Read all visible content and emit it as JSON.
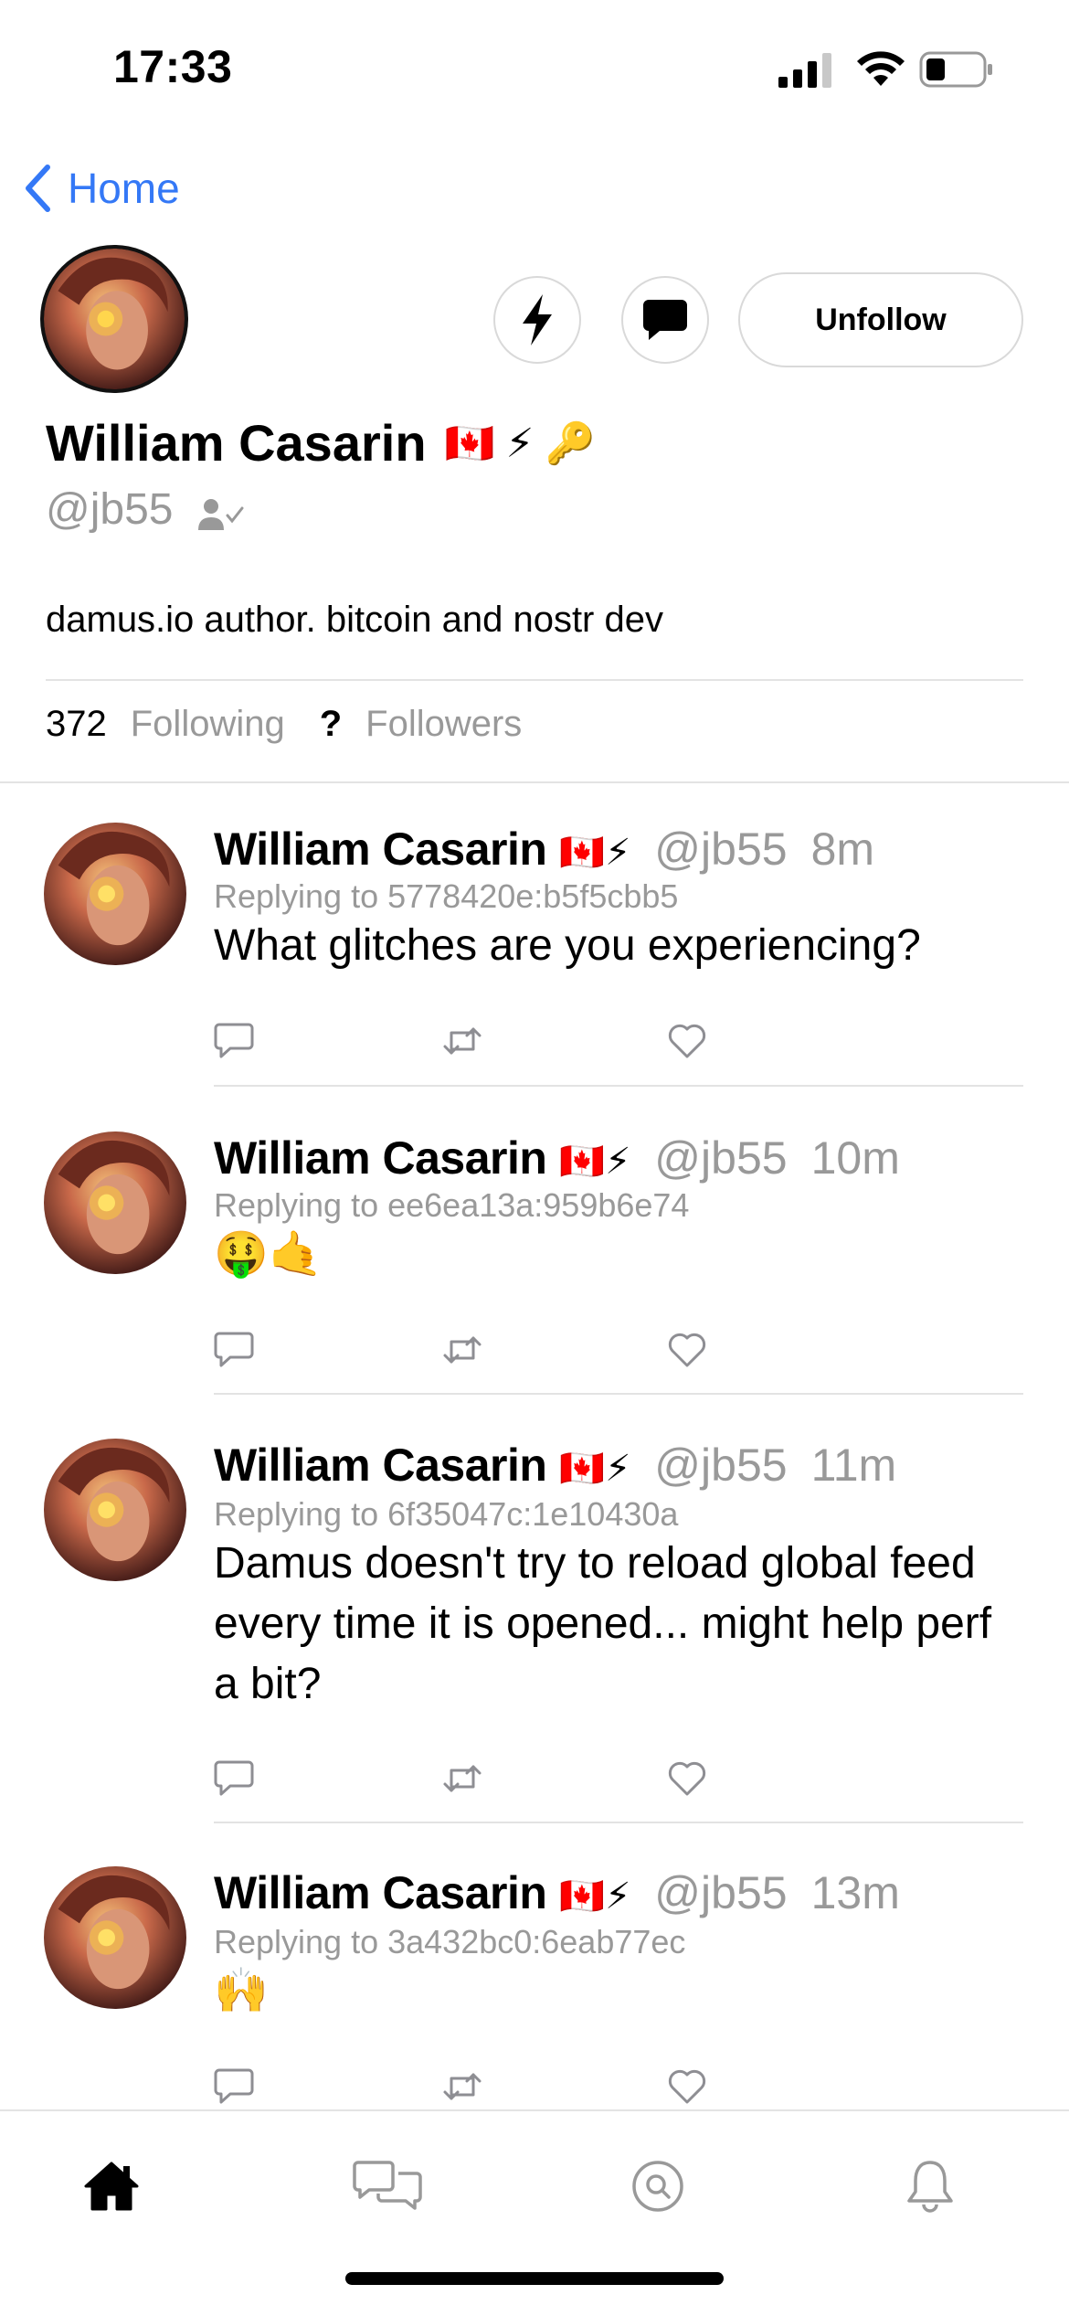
{
  "status_bar": {
    "time": "17:33"
  },
  "nav": {
    "back_label": "Home"
  },
  "profile": {
    "display_name": "William Casarin",
    "name_emojis": "🇨🇦 ⚡ 🔑",
    "handle": "@jb55",
    "about": "damus.io author. bitcoin and nostr dev",
    "following_count": "372",
    "following_label": "Following",
    "followers_count": "?",
    "followers_label": "Followers",
    "unfollow_label": "Unfollow"
  },
  "posts": [
    {
      "name": "William Casarin",
      "flags": "🇨🇦⚡",
      "handle": "@jb55",
      "time": "8m",
      "replying_to": "Replying to 5778420e:b5f5cbb5",
      "text": "What glitches are you experiencing?"
    },
    {
      "name": "William Casarin",
      "flags": "🇨🇦⚡",
      "handle": "@jb55",
      "time": "10m",
      "replying_to": "Replying to ee6ea13a:959b6e74",
      "text": "🤑🤙"
    },
    {
      "name": "William Casarin",
      "flags": "🇨🇦⚡",
      "handle": "@jb55",
      "time": "11m",
      "replying_to": "Replying to 6f35047c:1e10430a",
      "text": "Damus doesn't try to reload global feed every time it is opened... might help perf a bit?"
    },
    {
      "name": "William Casarin",
      "flags": "🇨🇦⚡",
      "handle": "@jb55",
      "time": "13m",
      "replying_to": "Replying to 3a432bc0:6eab77ec",
      "text": "🙌"
    }
  ],
  "icons": {
    "zap": "bolt-icon",
    "dm": "message-bubble-icon",
    "verified": "person-check-icon",
    "reply": "reply-icon",
    "repost": "repost-icon",
    "like": "heart-icon",
    "tabs": [
      "home-icon",
      "chats-icon",
      "search-icon",
      "bell-icon"
    ]
  },
  "colors": {
    "accent": "#3478f6",
    "muted": "#999999",
    "divider": "#e3e3e3"
  }
}
